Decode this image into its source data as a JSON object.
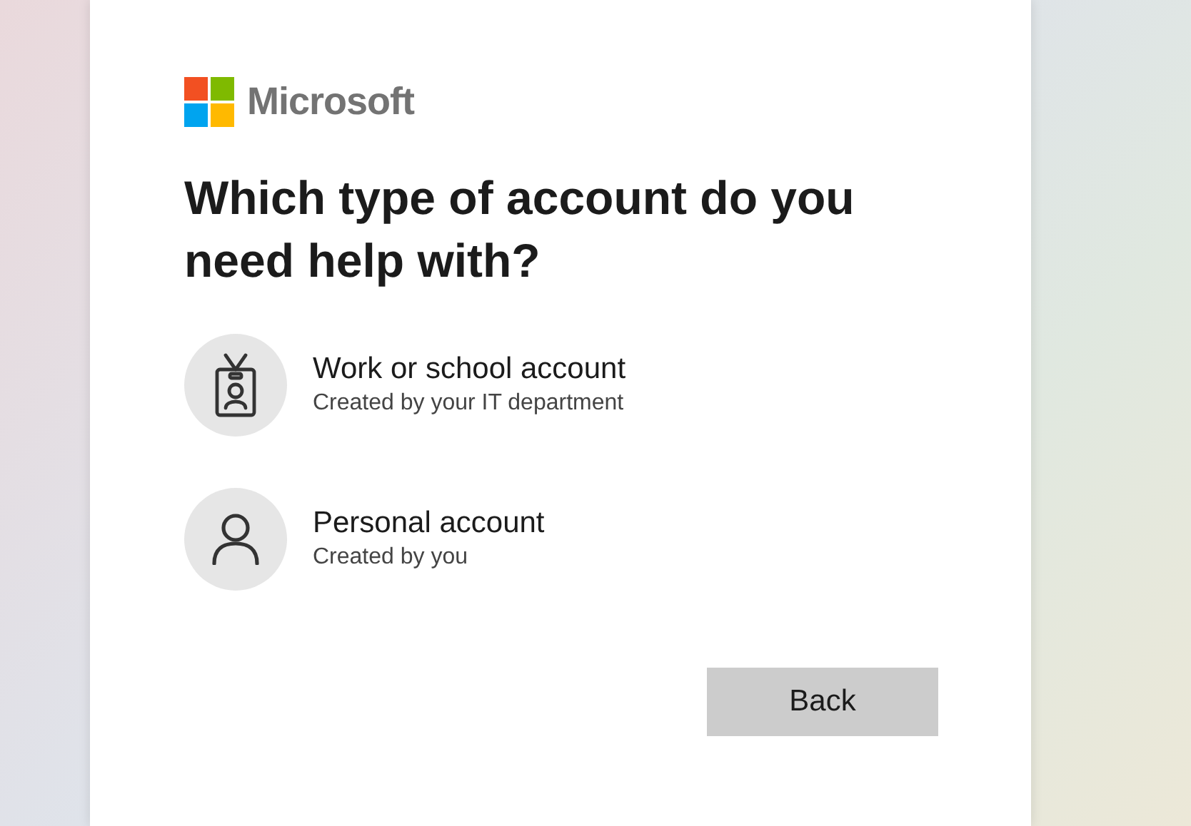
{
  "logo": {
    "text": "Microsoft"
  },
  "heading": "Which type of account do you need help with?",
  "options": [
    {
      "kind": "work",
      "title": "Work or school account",
      "subtitle": "Created by your IT department"
    },
    {
      "kind": "personal",
      "title": "Personal account",
      "subtitle": "Created by you"
    }
  ],
  "buttons": [
    {
      "label": "Back"
    }
  ]
}
